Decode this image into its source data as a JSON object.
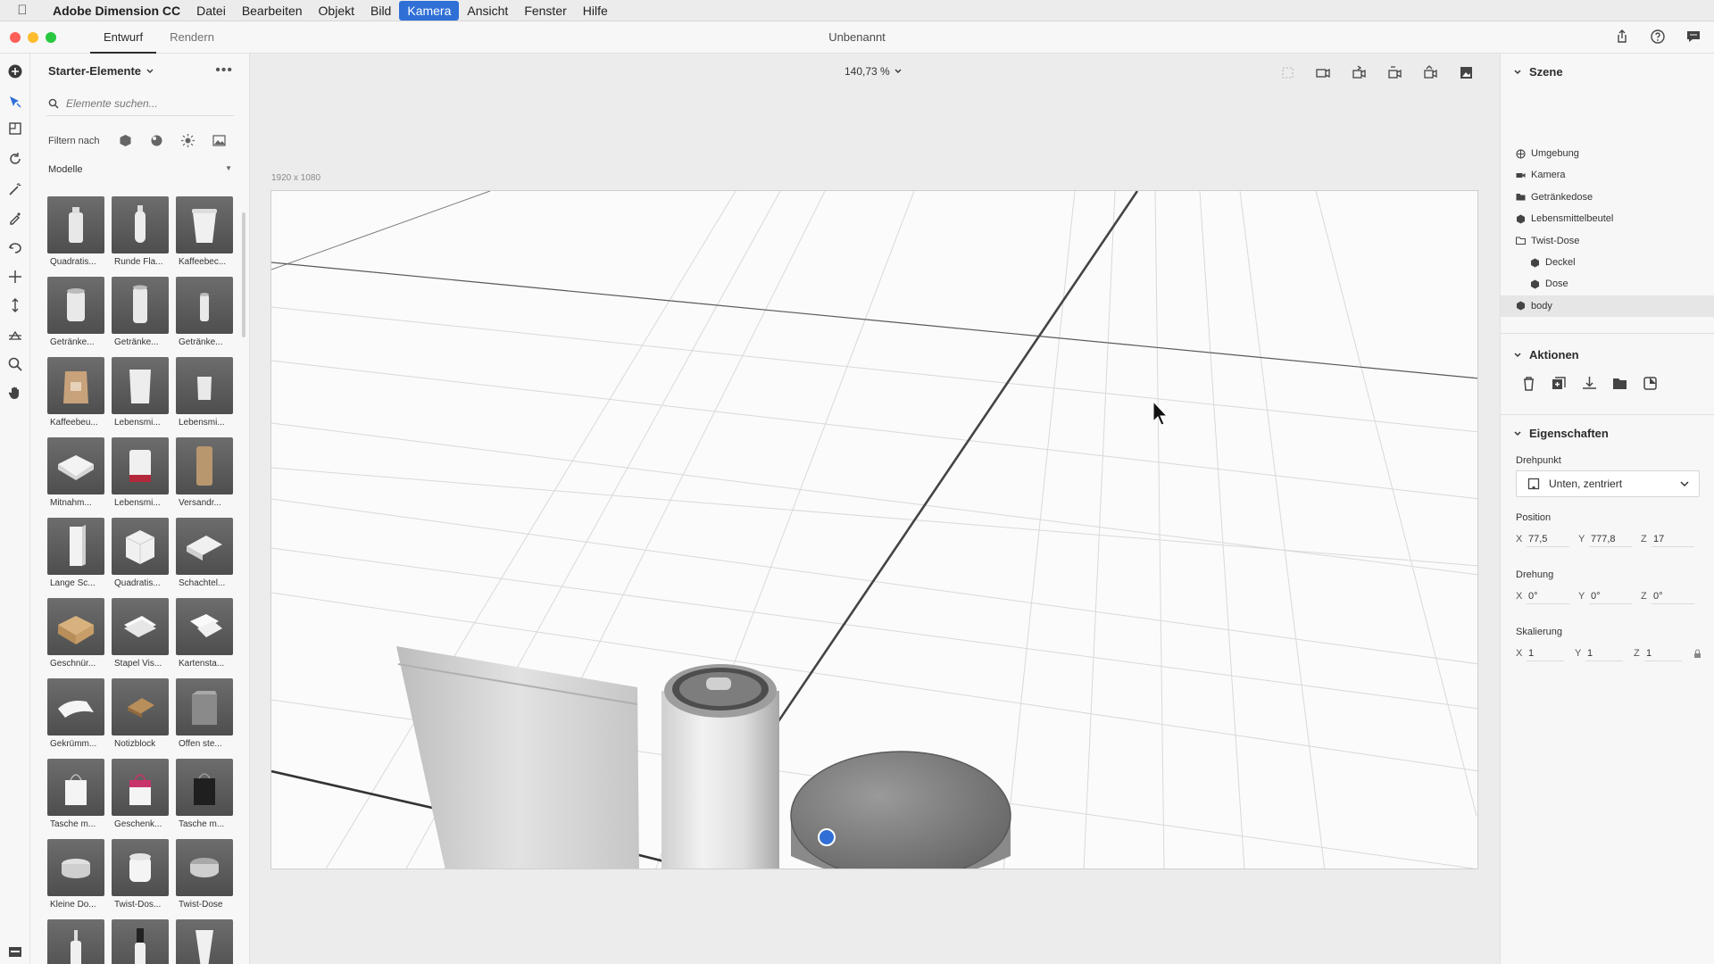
{
  "menubar": {
    "app_name": "Adobe Dimension CC",
    "items": [
      "Datei",
      "Bearbeiten",
      "Objekt",
      "Bild",
      "Kamera",
      "Ansicht",
      "Fenster",
      "Hilfe"
    ],
    "active_item": "Kamera"
  },
  "titlebar": {
    "tabs": [
      "Entwurf",
      "Rendern"
    ],
    "active_tab": "Entwurf",
    "document_title": "Unbenannt"
  },
  "assets": {
    "header": "Starter-Elemente",
    "search_placeholder": "Elemente suchen...",
    "filter_label": "Filtern nach",
    "section_label": "Modelle",
    "items": [
      {
        "label": "Quadratis...",
        "shape": "bottle-square"
      },
      {
        "label": "Runde Fla...",
        "shape": "bottle-round"
      },
      {
        "label": "Kaffeebec...",
        "shape": "cup"
      },
      {
        "label": "Getränke...",
        "shape": "can"
      },
      {
        "label": "Getränke...",
        "shape": "can-tall"
      },
      {
        "label": "Getränke...",
        "shape": "can-slim"
      },
      {
        "label": "Kaffeebeu...",
        "shape": "bag-brown"
      },
      {
        "label": "Lebensmi...",
        "shape": "pouch"
      },
      {
        "label": "Lebensmi...",
        "shape": "pouch-small"
      },
      {
        "label": "Mitnahm...",
        "shape": "takeout"
      },
      {
        "label": "Lebensmi...",
        "shape": "tub-red"
      },
      {
        "label": "Versandr...",
        "shape": "tube-kraft"
      },
      {
        "label": "Lange Sc...",
        "shape": "box-tall"
      },
      {
        "label": "Quadratis...",
        "shape": "box-cube"
      },
      {
        "label": "Schachtel...",
        "shape": "box-flat"
      },
      {
        "label": "Geschnür...",
        "shape": "parcel"
      },
      {
        "label": "Stapel Vis...",
        "shape": "cards"
      },
      {
        "label": "Kartensta...",
        "shape": "cards-stack"
      },
      {
        "label": "Gekrümm...",
        "shape": "paper"
      },
      {
        "label": "Notizblock",
        "shape": "notepad"
      },
      {
        "label": "Offen ste...",
        "shape": "box-open"
      },
      {
        "label": "Tasche m...",
        "shape": "bag-white"
      },
      {
        "label": "Geschenk...",
        "shape": "bag-pink"
      },
      {
        "label": "Tasche m...",
        "shape": "bag-black"
      },
      {
        "label": "Kleine Do...",
        "shape": "tin-small"
      },
      {
        "label": "Twist-Dos...",
        "shape": "jar"
      },
      {
        "label": "Twist-Dose",
        "shape": "tin-twist"
      },
      {
        "label": "",
        "shape": "pump"
      },
      {
        "label": "",
        "shape": "dropper"
      },
      {
        "label": "",
        "shape": "tube"
      }
    ]
  },
  "canvas": {
    "zoom": "140,73 %",
    "size_label": "1920 x 1080"
  },
  "scene": {
    "header": "Szene",
    "items": [
      {
        "label": "Umgebung",
        "icon": "environment-icon",
        "indent": 0,
        "selected": false
      },
      {
        "label": "Kamera",
        "icon": "camera-icon",
        "indent": 0,
        "selected": false
      },
      {
        "label": "Getränkedose",
        "icon": "folder-icon",
        "indent": 0,
        "selected": false
      },
      {
        "label": "Lebensmittelbeutel",
        "icon": "model-icon",
        "indent": 0,
        "selected": false
      },
      {
        "label": "Twist-Dose",
        "icon": "folder-outline-icon",
        "indent": 0,
        "selected": false
      },
      {
        "label": "Deckel",
        "icon": "model-icon",
        "indent": 1,
        "selected": false
      },
      {
        "label": "Dose",
        "icon": "model-icon",
        "indent": 1,
        "selected": false
      },
      {
        "label": "body",
        "icon": "model-icon",
        "indent": 0,
        "selected": true
      }
    ]
  },
  "actions": {
    "header": "Aktionen"
  },
  "properties": {
    "header": "Eigenschaften",
    "pivot_label": "Drehpunkt",
    "pivot_value": "Unten, zentriert",
    "position_label": "Position",
    "position": {
      "x": "77,5",
      "y": "777,8",
      "z": "17"
    },
    "rotation_label": "Drehung",
    "rotation": {
      "x": "0°",
      "y": "0°",
      "z": "0°"
    },
    "scale_label": "Skalierung",
    "scale": {
      "x": "1",
      "y": "1",
      "z": "1"
    }
  }
}
